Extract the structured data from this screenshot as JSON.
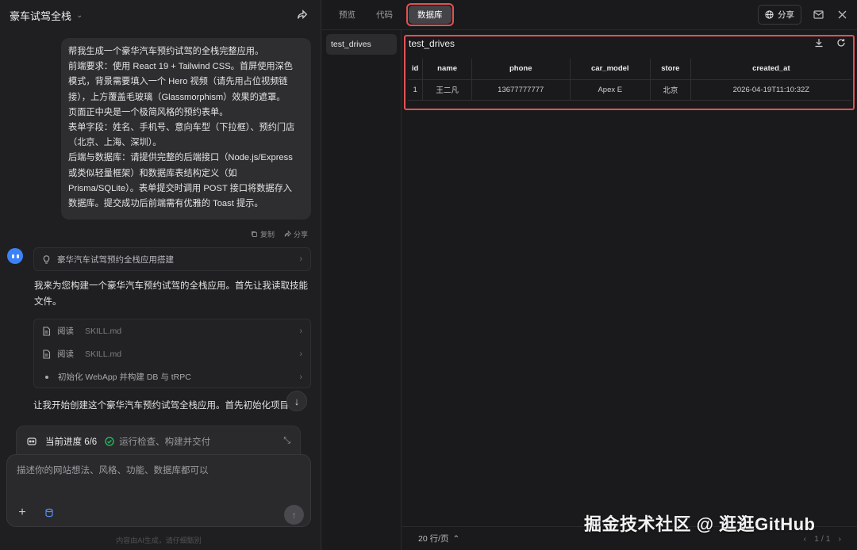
{
  "project": {
    "title": "豪车试驾全栈"
  },
  "chat": {
    "user_message_lines": [
      "帮我生成一个豪华汽车预约试驾的全栈完整应用。",
      "前端要求：使用 React 19 + Tailwind CSS。首屏使用深色",
      "模式，背景需要填入一个 Hero 视频（请先用占位视频链",
      "接），上方覆盖毛玻璃（Glassmorphism）效果的遮罩。",
      "页面正中央是一个极简风格的预约表单。",
      "表单字段：姓名、手机号、意向车型（下拉框）、预约门店",
      "（北京、上海、深圳）。",
      "后端与数据库：请提供完整的后端接口（Node.js/Express",
      "或类似轻量框架）和数据库表结构定义（如",
      "Prisma/SQLite）。表单提交时调用 POST 接口将数据存入",
      "数据库。提交成功后前端需有优雅的 Toast 提示。"
    ],
    "copy_label": "复制",
    "share_label": "分享",
    "thinking_title": "豪华汽车试驾预约全栈应用搭建",
    "ai_message_1": "我来为您构建一个豪华汽车预约试驾的全栈应用。首先让我读取技能文件。",
    "tools": [
      {
        "action": "阅读",
        "file": "SKILL.md"
      },
      {
        "action": "阅读",
        "file": "SKILL.md"
      },
      {
        "action": "初始化 WebApp 并构建 DB 与 tRPC",
        "file": ""
      }
    ],
    "ai_message_2": "让我开始创建这个豪华汽车预约试驾全栈应用。首先初始化项目",
    "progress": {
      "label": "当前进度 6/6",
      "step": "运行检查、构建并交付"
    },
    "composer_placeholder": "描述你的网站想法、风格、功能、数据库都可以",
    "disclaimer": "内容由AI生成，请仔细甄别"
  },
  "preview": {
    "tabs": [
      "预览",
      "代码",
      "数据库"
    ],
    "active_tab": "数据库",
    "share_label": "分享",
    "tables": [
      "test_drives"
    ],
    "grid": {
      "title": "test_drives",
      "columns": [
        "id",
        "name",
        "phone",
        "car_model",
        "store",
        "created_at"
      ],
      "rows": [
        [
          "1",
          "王二凡",
          "13677777777",
          "Apex E",
          "北京",
          "2026-04-19T11:10:32Z"
        ]
      ]
    },
    "pager": {
      "rows_per_page": "20 行/页",
      "page": "1 / 1"
    }
  },
  "watermark": "掘金技术社区 @ 逛逛GitHub",
  "colors": {
    "highlight": "#e35252",
    "accent": "#3b82f6",
    "success": "#22c55e"
  }
}
